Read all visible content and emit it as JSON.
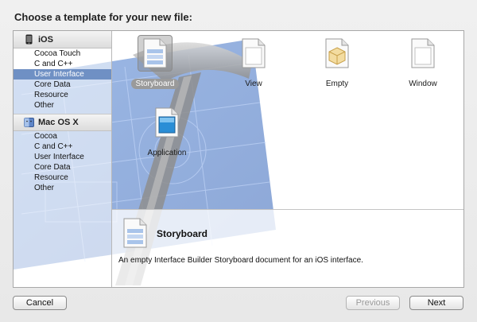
{
  "header": {
    "title": "Choose a template for your new file:"
  },
  "sidebar": {
    "groups": [
      {
        "label": "iOS",
        "icon": "iphone-icon",
        "items": [
          "Cocoa Touch",
          "C and C++",
          "User Interface",
          "Core Data",
          "Resource",
          "Other"
        ],
        "selected": "User Interface"
      },
      {
        "label": "Mac OS X",
        "icon": "finder-icon",
        "items": [
          "Cocoa",
          "C and C++",
          "User Interface",
          "Core Data",
          "Resource",
          "Other"
        ]
      }
    ]
  },
  "templates": [
    {
      "label": "Storyboard",
      "icon": "storyboard-file-icon",
      "selected": true
    },
    {
      "label": "View",
      "icon": "view-file-icon"
    },
    {
      "label": "Empty",
      "icon": "empty-file-icon"
    },
    {
      "label": "Window",
      "icon": "window-file-icon"
    },
    {
      "label": "Application",
      "icon": "application-file-icon"
    }
  ],
  "detail": {
    "name": "Storyboard",
    "description": "An empty Interface Builder Storyboard document for an iOS interface."
  },
  "buttons": {
    "cancel": "Cancel",
    "previous": "Previous",
    "next": "Next"
  },
  "colors": {
    "selection": "#6f90c4",
    "blueprint": "#3d6fc4"
  }
}
